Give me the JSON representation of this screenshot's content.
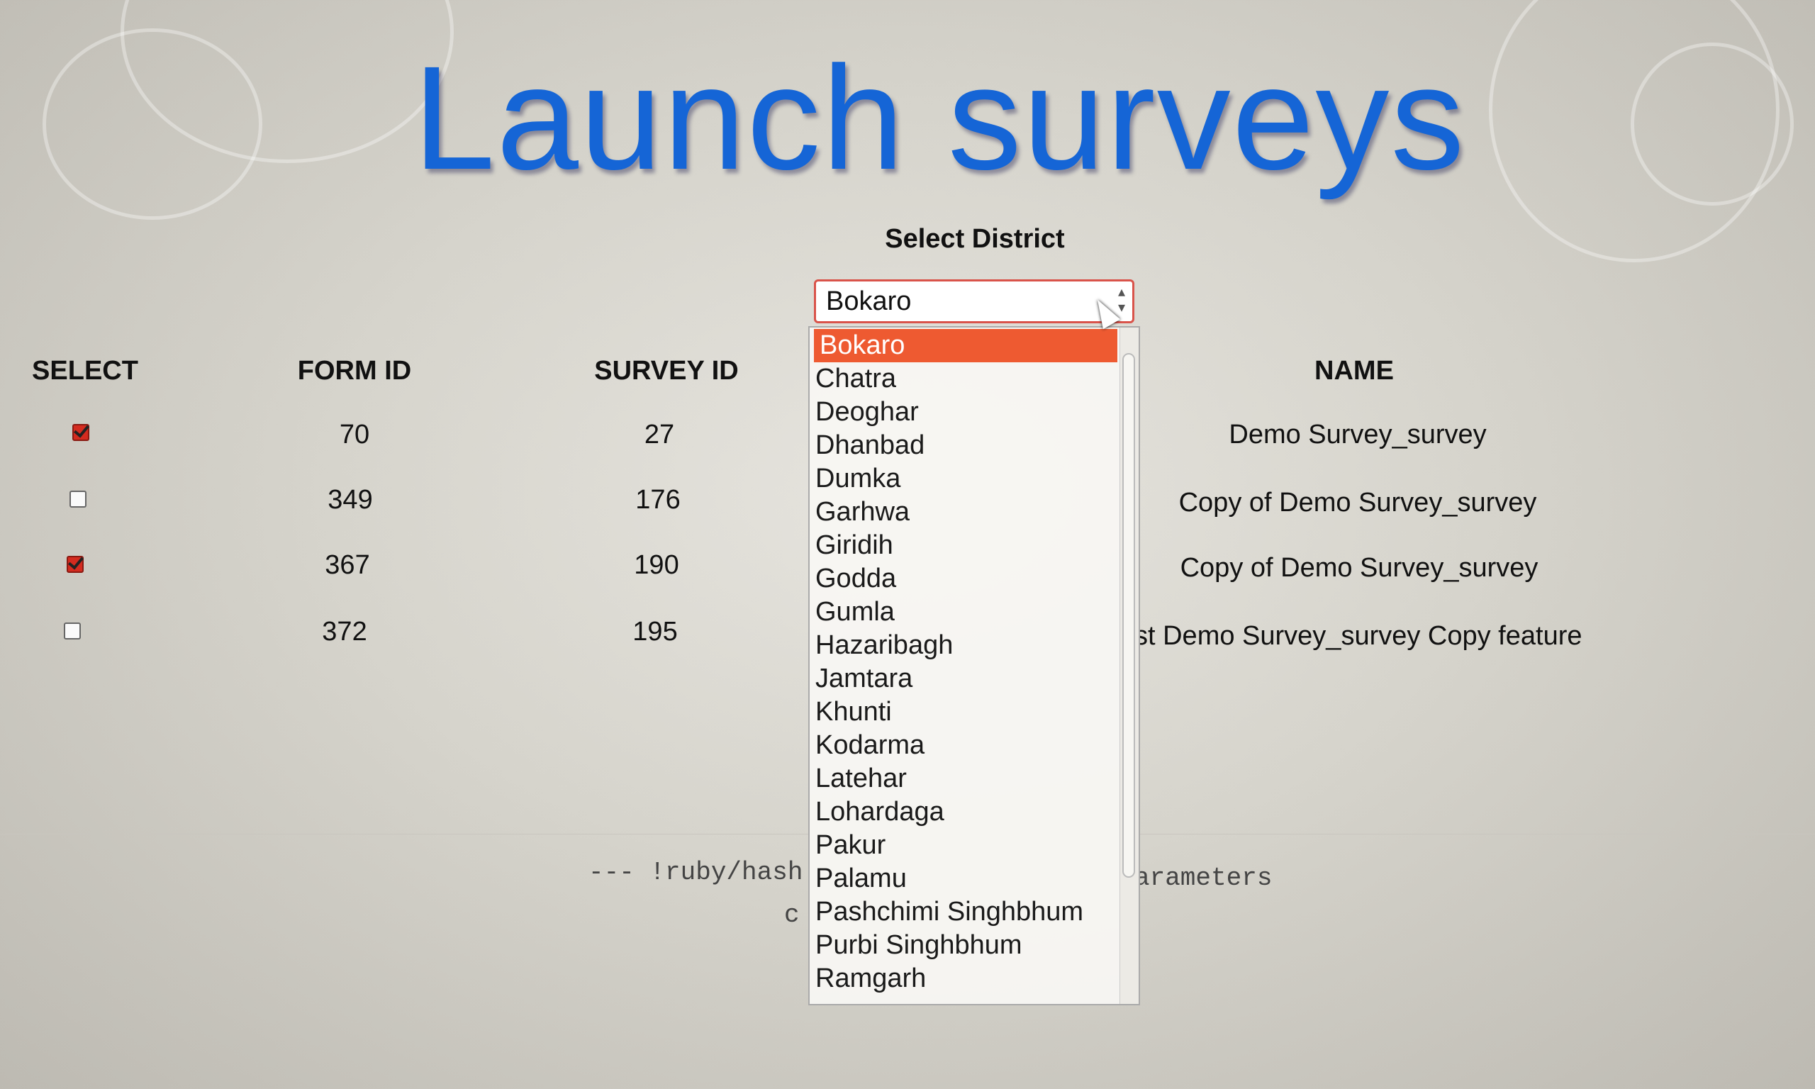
{
  "page": {
    "title": "Launch surveys"
  },
  "district": {
    "label": "Select District",
    "selected": "Bokaro",
    "options": [
      "Bokaro",
      "Chatra",
      "Deoghar",
      "Dhanbad",
      "Dumka",
      "Garhwa",
      "Giridih",
      "Godda",
      "Gumla",
      "Hazaribagh",
      "Jamtara",
      "Khunti",
      "Kodarma",
      "Latehar",
      "Lohardaga",
      "Pakur",
      "Palamu",
      "Pashchimi Singhbhum",
      "Purbi Singhbhum",
      "Ramgarh"
    ]
  },
  "table": {
    "headers": {
      "select": "SELECT",
      "form_id": "FORM ID",
      "survey_id": "SURVEY ID",
      "name": "NAME"
    },
    "rows": [
      {
        "checked": true,
        "form_id": "70",
        "survey_id": "27",
        "name": "Demo Survey_survey"
      },
      {
        "checked": false,
        "form_id": "349",
        "survey_id": "176",
        "name": "Copy of Demo Survey_survey"
      },
      {
        "checked": true,
        "form_id": "367",
        "survey_id": "190",
        "name": "Copy of Demo Survey_survey"
      },
      {
        "checked": false,
        "form_id": "372",
        "survey_id": "195",
        "name": "st Demo Survey_survey Copy feature"
      }
    ]
  },
  "debug": {
    "line1_left": "--- !ruby/hash",
    "line1_right": "arameters",
    "line2": "c"
  },
  "colors": {
    "title": "#1565d6",
    "highlight": "#ee5a31",
    "checkbox_checked": "#d42b1f"
  }
}
